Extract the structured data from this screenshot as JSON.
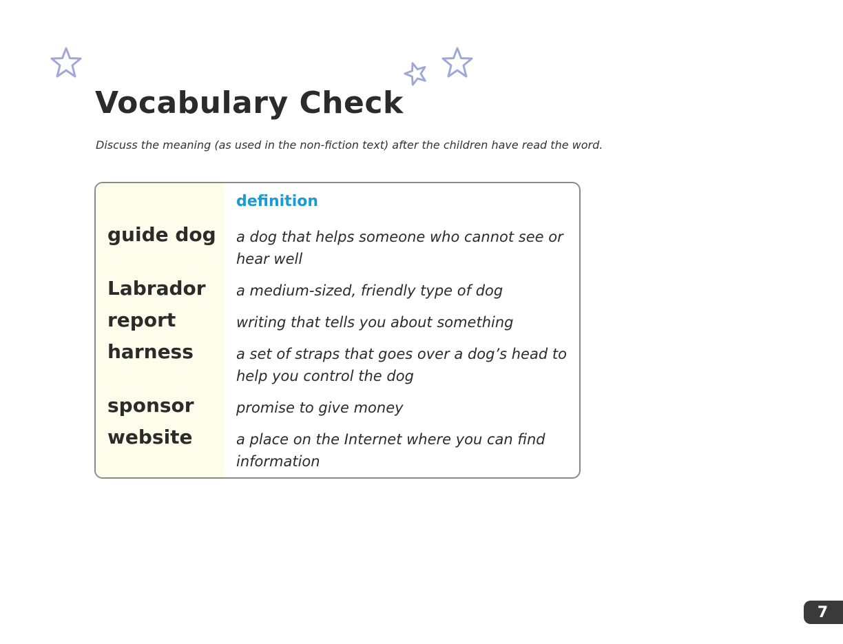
{
  "decorations": {
    "star_color": "#a0a8d8",
    "stars": [
      "star-icon",
      "star-icon",
      "star-icon"
    ]
  },
  "page": {
    "title": "Vocabulary Check",
    "instructions": "Discuss the meaning (as used in the non-fiction text) after the children have read the word.",
    "page_number": "7"
  },
  "table": {
    "header": "definition",
    "header_color": "#1a9bd6",
    "word_column_color": "#fdfdec",
    "rows": [
      {
        "word": "guide dog",
        "definition": "a dog that helps someone who cannot see or hear well"
      },
      {
        "word": "Labrador",
        "definition": "a medium-sized, friendly type of dog"
      },
      {
        "word": "report",
        "definition": "writing that tells you about something"
      },
      {
        "word": "harness",
        "definition": "a set of straps that goes over a dog’s head to help you control the dog"
      },
      {
        "word": "sponsor",
        "definition": "promise to give money"
      },
      {
        "word": "website",
        "definition": "a place on the Internet where you can find information"
      }
    ]
  }
}
